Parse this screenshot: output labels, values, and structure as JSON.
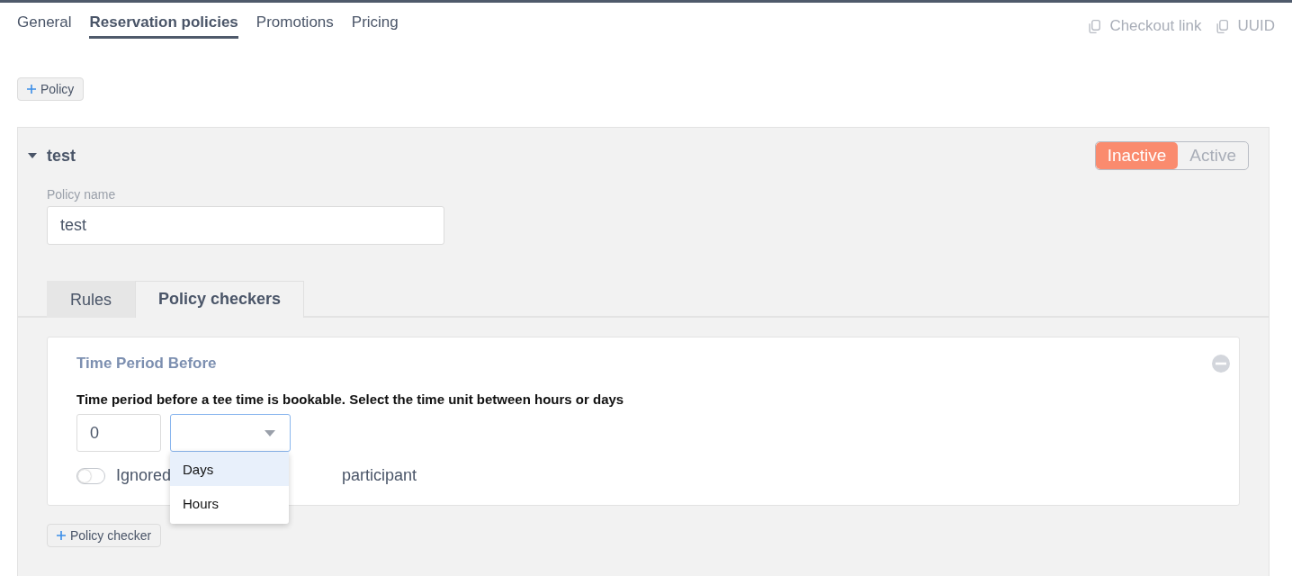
{
  "tabs": [
    {
      "label": "General",
      "selected": false
    },
    {
      "label": "Reservation policies",
      "selected": true
    },
    {
      "label": "Promotions",
      "selected": false
    },
    {
      "label": "Pricing",
      "selected": false
    }
  ],
  "header_links": [
    "Checkout link",
    "UUID"
  ],
  "add_policy_button": "Policy",
  "policy": {
    "title": "test",
    "expanded": true,
    "status": [
      {
        "label": "Inactive",
        "selected": true
      },
      {
        "label": "Active",
        "selected": false
      }
    ],
    "name_label": "Policy name",
    "name_value": "test",
    "subtabs": [
      {
        "label": "Rules",
        "selected": false
      },
      {
        "label": "Policy checkers",
        "selected": true
      }
    ],
    "checker": {
      "title": "Time Period Before",
      "description": "Time period before a tee time is bookable. Select the time unit between hours or days",
      "amount": "0",
      "unit_options": [
        {
          "label": "Days",
          "selected": true
        },
        {
          "label": "Hours",
          "selected": false
        }
      ],
      "toggle": {
        "on": false,
        "label_start": "Ignored",
        "label_end": "participant"
      }
    },
    "add_checker_button": "Policy checker"
  }
}
